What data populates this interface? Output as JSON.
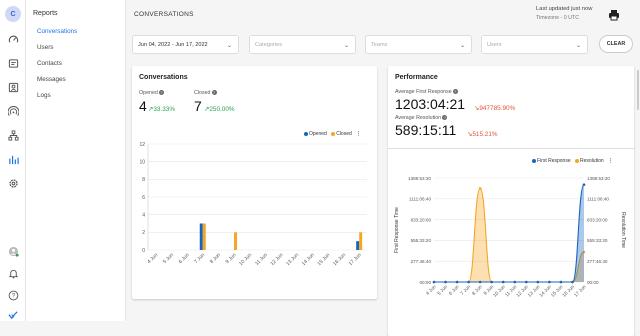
{
  "app": {
    "avatar_initial": "C"
  },
  "rail_icons": [
    "dashboard-icon",
    "inbox-icon",
    "contacts-icon",
    "broadcast-icon",
    "hierarchy-icon",
    "reports-icon",
    "settings-icon"
  ],
  "sidebar": {
    "title": "Reports",
    "items": [
      {
        "label": "Conversations",
        "active": true
      },
      {
        "label": "Users",
        "active": false
      },
      {
        "label": "Contacts",
        "active": false
      },
      {
        "label": "Messages",
        "active": false
      },
      {
        "label": "Logs",
        "active": false
      }
    ]
  },
  "header": {
    "title": "CONVERSATIONS",
    "last_updated": "Last updated just now",
    "timezone": "Timezone - 0 UTC"
  },
  "filters": {
    "date_range": "Jun 04, 2022 - Jun 17, 2022",
    "categories_placeholder": "Categories",
    "teams_placeholder": "Teams",
    "users_placeholder": "Users",
    "clear_label": "CLEAR"
  },
  "conversations": {
    "title": "Conversations",
    "opened_label": "Opened",
    "opened_value": "4",
    "opened_delta": "33.33%",
    "closed_label": "Closed",
    "closed_value": "7",
    "closed_delta": "250.00%",
    "legend_opened": "Opened",
    "legend_closed": "Closed"
  },
  "performance": {
    "title": "Performance",
    "first_response_label": "Average First Response",
    "first_response_value": "1203:04:21",
    "first_response_delta": "947785.90%",
    "resolution_label": "Average Resolution",
    "resolution_value": "589:15:11",
    "resolution_delta": "515.21%",
    "legend_first": "First Response",
    "legend_resolution": "Resolution",
    "left_axis_label": "First Response Time",
    "right_axis_label": "Resolution Time"
  },
  "colors": {
    "blue": "#1565c0",
    "orange": "#f5a623",
    "green": "#2e9d4f",
    "red": "#e0533d",
    "accent": "#1a73e8"
  },
  "chart_data": [
    {
      "type": "bar",
      "categories": [
        "4 Jun",
        "5 Jun",
        "6 Jun",
        "7 Jun",
        "8 Jun",
        "9 Jun",
        "10 Jun",
        "11 Jun",
        "12 Jun",
        "13 Jun",
        "14 Jun",
        "15 Jun",
        "16 Jun",
        "17 Jun"
      ],
      "series": [
        {
          "name": "Opened",
          "values": [
            0,
            0,
            0,
            3,
            0,
            0,
            0,
            0,
            0,
            0,
            0,
            0,
            0,
            1
          ]
        },
        {
          "name": "Closed",
          "values": [
            0,
            0,
            0,
            3,
            0,
            2,
            0,
            0,
            0,
            0,
            0,
            0,
            0,
            2
          ]
        }
      ],
      "ylim": [
        0,
        12
      ],
      "yticks": [
        0,
        2,
        4,
        6,
        8,
        10,
        12
      ],
      "legend": "top-right",
      "grid": true
    },
    {
      "type": "area",
      "categories": [
        "4 Jun",
        "5 Jun",
        "6 Jun",
        "7 Jun",
        "8 Jun",
        "9 Jun",
        "10 Jun",
        "11 Jun",
        "12 Jun",
        "13 Jun",
        "14 Jun",
        "15 Jun",
        "16 Jun",
        "17 Jun"
      ],
      "series": [
        {
          "name": "First Response",
          "values": [
            0,
            0,
            0,
            0,
            0,
            0,
            0,
            0,
            0,
            0,
            0,
            0,
            0,
            1300
          ]
        },
        {
          "name": "Resolution",
          "values": [
            0,
            0,
            0,
            0,
            1250,
            0,
            0,
            0,
            0,
            0,
            0,
            0,
            0,
            400
          ]
        }
      ],
      "yticks_left": [
        "00:00",
        "277:46:40",
        "555:33:20",
        "833:20:00",
        "1111:06:40",
        "1388:53:20"
      ],
      "yticks_right": [
        "00:00",
        "277:46:40",
        "555:33:20",
        "833:20:00",
        "1111:06:40",
        "1388:53:20"
      ],
      "ylim": [
        0,
        1388.89
      ],
      "legend": "top-right",
      "grid": true
    }
  ]
}
